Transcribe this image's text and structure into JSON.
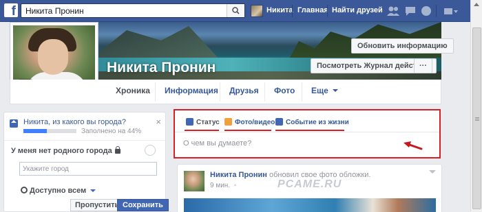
{
  "nav": {
    "search_value": "Никита Пронин",
    "user_name": "Никита",
    "home": "Главная",
    "find_friends": "Найти друзей"
  },
  "profile": {
    "name": "Никита Пронин",
    "update_info": "Обновить информацию",
    "activity_log": "Посмотреть Журнал действий",
    "more_dots": "···"
  },
  "tabs": [
    {
      "label": "Хроника"
    },
    {
      "label": "Информация"
    },
    {
      "label": "Друзья"
    },
    {
      "label": "Фото"
    },
    {
      "label": "Еще"
    }
  ],
  "city_card": {
    "question": "Никита, из какого вы города?",
    "progress_text": "Заполнено на 44%",
    "progress_value": 0.44,
    "close": "×",
    "no_city": "У меня нет родного города",
    "city_placeholder": "Укажите город",
    "privacy": "Доступно всем",
    "skip": "Пропустить",
    "save": "Сохранить"
  },
  "composer": {
    "tabs": [
      {
        "label": "Статус",
        "icon": "pencil-icon"
      },
      {
        "label": "Фото/видео",
        "icon": "photo-icon"
      },
      {
        "label": "Событие из жизни",
        "icon": "flag-icon"
      }
    ],
    "placeholder": "О чем вы думаете?"
  },
  "post": {
    "author": "Никита Пронин",
    "action": "обновил свое фото обложки.",
    "time": "9 мин.",
    "watermark": "PCAME.RU"
  },
  "colors": {
    "facebook_blue": "#3b5998",
    "highlight_red": "#d91f26",
    "link_blue": "#365899"
  }
}
